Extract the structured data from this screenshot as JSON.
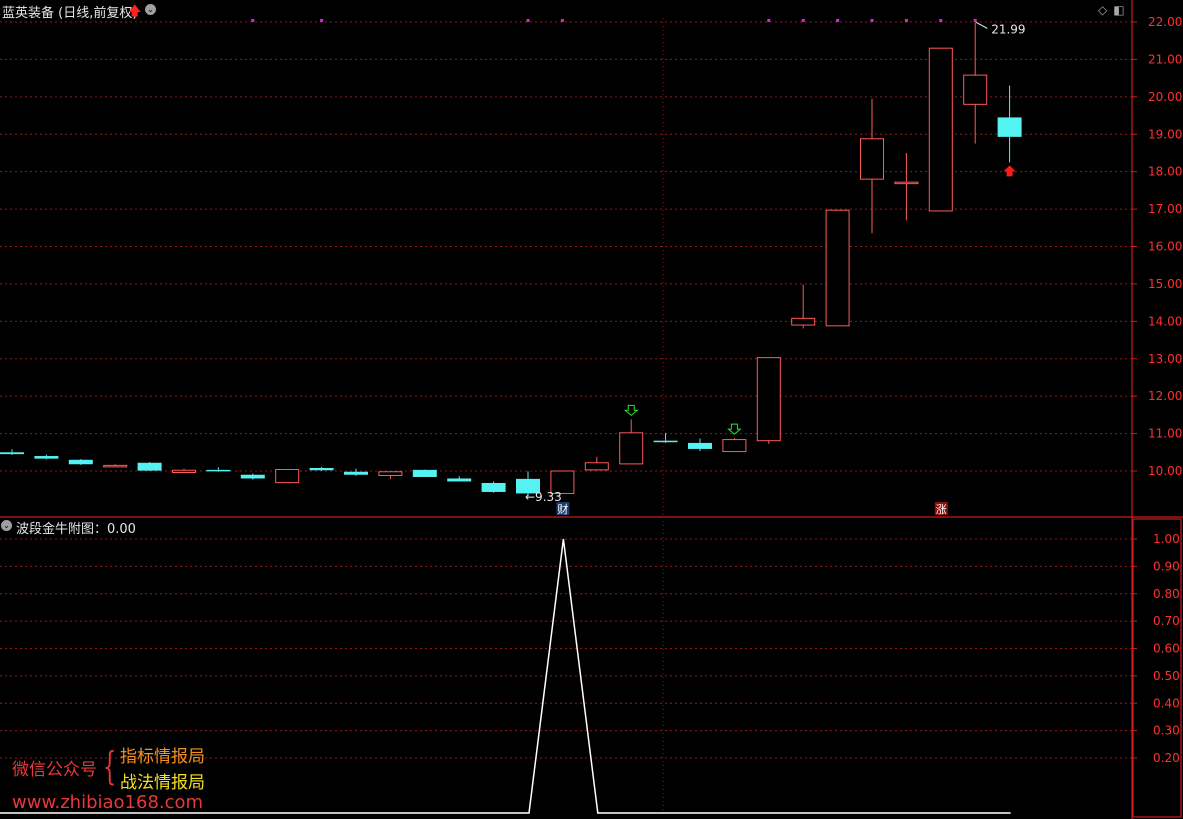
{
  "header": {
    "title": "蓝英装备 (日线,前复权)",
    "indicator_label": "波段金牛附图：0.00"
  },
  "watermark": {
    "wechat": "微信公众号",
    "line1": "指标情报局",
    "line2": "战法情报局",
    "url": "www.zhibiao168.com"
  },
  "colors": {
    "background": "#000000",
    "up": "#ff5a5a",
    "down": "#54f2f2",
    "axis": "#c81e1e",
    "grid": "#8c1e1e",
    "label": "#ff3030",
    "magenta": "#e020e0",
    "indicator_line": "#ffffff"
  },
  "chart_data": [
    {
      "type": "candlestick",
      "title": "蓝英装备 (日线,前复权)",
      "ylim": [
        9.2,
        22.3
      ],
      "y_ticks": [
        "22.00",
        "21.00",
        "20.00",
        "19.00",
        "18.00",
        "17.00",
        "16.00",
        "15.00",
        "14.00",
        "13.00",
        "12.00",
        "11.00",
        "10.00"
      ],
      "grid": true,
      "candles": [
        {
          "o": 10.5,
          "h": 10.58,
          "l": 10.43,
          "c": 10.45
        },
        {
          "o": 10.4,
          "h": 10.44,
          "l": 10.31,
          "c": 10.33
        },
        {
          "o": 10.3,
          "h": 10.32,
          "l": 10.16,
          "c": 10.18
        },
        {
          "o": 10.13,
          "h": 10.18,
          "l": 10.11,
          "c": 10.15
        },
        {
          "o": 10.22,
          "h": 10.24,
          "l": 10.0,
          "c": 10.01
        },
        {
          "o": 9.96,
          "h": 10.06,
          "l": 9.94,
          "c": 10.02
        },
        {
          "o": 10.03,
          "h": 10.1,
          "l": 9.98,
          "c": 9.99
        },
        {
          "o": 9.9,
          "h": 9.93,
          "l": 9.77,
          "c": 9.8
        },
        {
          "o": 9.69,
          "h": 10.05,
          "l": 9.69,
          "c": 10.04
        },
        {
          "o": 10.08,
          "h": 10.11,
          "l": 10.0,
          "c": 10.02
        },
        {
          "o": 9.98,
          "h": 10.06,
          "l": 9.87,
          "c": 9.9
        },
        {
          "o": 9.88,
          "h": 9.93,
          "l": 9.78,
          "c": 9.98
        },
        {
          "o": 10.03,
          "h": 10.04,
          "l": 9.84,
          "c": 9.84
        },
        {
          "o": 9.8,
          "h": 9.86,
          "l": 9.72,
          "c": 9.72
        },
        {
          "o": 9.68,
          "h": 9.72,
          "l": 9.42,
          "c": 9.44
        },
        {
          "o": 9.79,
          "h": 9.99,
          "l": 9.33,
          "c": 9.4
        },
        {
          "o": 9.4,
          "h": 10.0,
          "l": 9.4,
          "c": 10.0
        },
        {
          "o": 10.03,
          "h": 10.38,
          "l": 10.03,
          "c": 10.22
        },
        {
          "o": 10.19,
          "h": 11.38,
          "l": 10.19,
          "c": 11.02
        },
        {
          "o": 10.81,
          "h": 11.02,
          "l": 10.75,
          "c": 10.77
        },
        {
          "o": 10.75,
          "h": 10.87,
          "l": 10.53,
          "c": 10.59
        },
        {
          "o": 10.52,
          "h": 10.88,
          "l": 10.52,
          "c": 10.84
        },
        {
          "o": 10.81,
          "h": 13.03,
          "l": 10.72,
          "c": 13.03
        },
        {
          "o": 13.9,
          "h": 14.98,
          "l": 13.81,
          "c": 14.08
        },
        {
          "o": 13.88,
          "h": 16.97,
          "l": 13.88,
          "c": 16.97
        },
        {
          "o": 17.8,
          "h": 19.95,
          "l": 16.35,
          "c": 18.88
        },
        {
          "o": 17.7,
          "h": 18.5,
          "l": 16.7,
          "c": 17.72
        },
        {
          "o": 16.95,
          "h": 21.3,
          "l": 16.95,
          "c": 21.3
        },
        {
          "o": 19.8,
          "h": 21.99,
          "l": 18.75,
          "c": 20.58
        },
        {
          "o": 19.45,
          "h": 20.3,
          "l": 18.25,
          "c": 18.93
        }
      ],
      "annotations": {
        "high_label": "21.99",
        "low_label": "9.33",
        "low_marker_prefix": "←",
        "buy_arrow_index": 29,
        "sell_arrow_indices": [
          18,
          21
        ],
        "markers": [
          "财",
          "涨"
        ],
        "marker_indices": [
          16,
          27
        ],
        "magenta_dot_indices": [
          7,
          9,
          15,
          16,
          22,
          23,
          24,
          25,
          26,
          27,
          28
        ]
      }
    },
    {
      "type": "line",
      "title": "波段金牛附图",
      "ylim": [
        0,
        1.05
      ],
      "y_ticks": [
        "1.00",
        "0.90",
        "0.80",
        "0.70",
        "0.60",
        "0.50",
        "0.40",
        "0.30",
        "0.20"
      ],
      "grid": true,
      "values": [
        0,
        0,
        0,
        0,
        0,
        0,
        0,
        0,
        0,
        0,
        0,
        0,
        0,
        0,
        0,
        0,
        1,
        0,
        0,
        0,
        0,
        0,
        0,
        0,
        0,
        0,
        0,
        0,
        0,
        0
      ]
    }
  ]
}
